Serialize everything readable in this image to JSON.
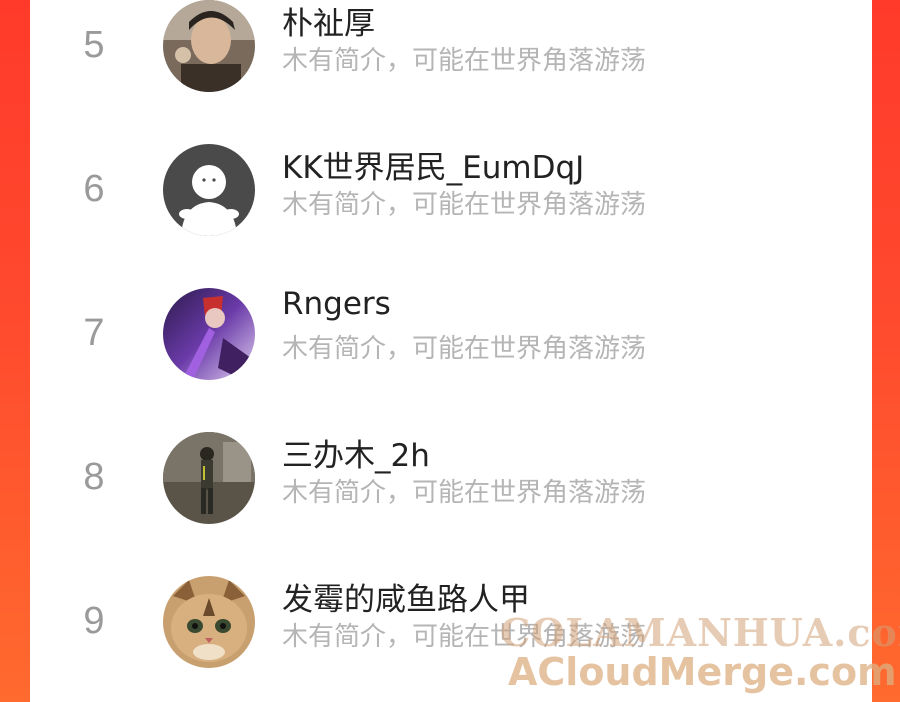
{
  "users": [
    {
      "rank": "5",
      "name": "朴祉厚",
      "bio": "木有简介，可能在世界角落游荡",
      "avatar": "photo-avatar-dark"
    },
    {
      "rank": "6",
      "name": "KK世界居民_EumDqJ",
      "bio": "木有简介，可能在世界角落游荡",
      "avatar": "default-avatar"
    },
    {
      "rank": "7",
      "name": "Rngers",
      "bio": "木有简介，可能在世界角落游荡",
      "avatar": "anime-avatar-purple"
    },
    {
      "rank": "8",
      "name": "三办木_2h",
      "bio": "木有简介，可能在世界角落游荡",
      "avatar": "photo-avatar-figure"
    },
    {
      "rank": "9",
      "name": "发霉的咸鱼路人甲",
      "bio": "木有简介，可能在世界角落游荡",
      "avatar": "cat-avatar"
    }
  ],
  "watermarks": [
    "COLAMANHUA.com",
    "ACloudMerge.com"
  ],
  "colors": {
    "background": "#ff4a2e",
    "panel": "#ffffff",
    "rank": "#9a9a9a",
    "name": "#222222",
    "bio": "#b5b5b5"
  }
}
